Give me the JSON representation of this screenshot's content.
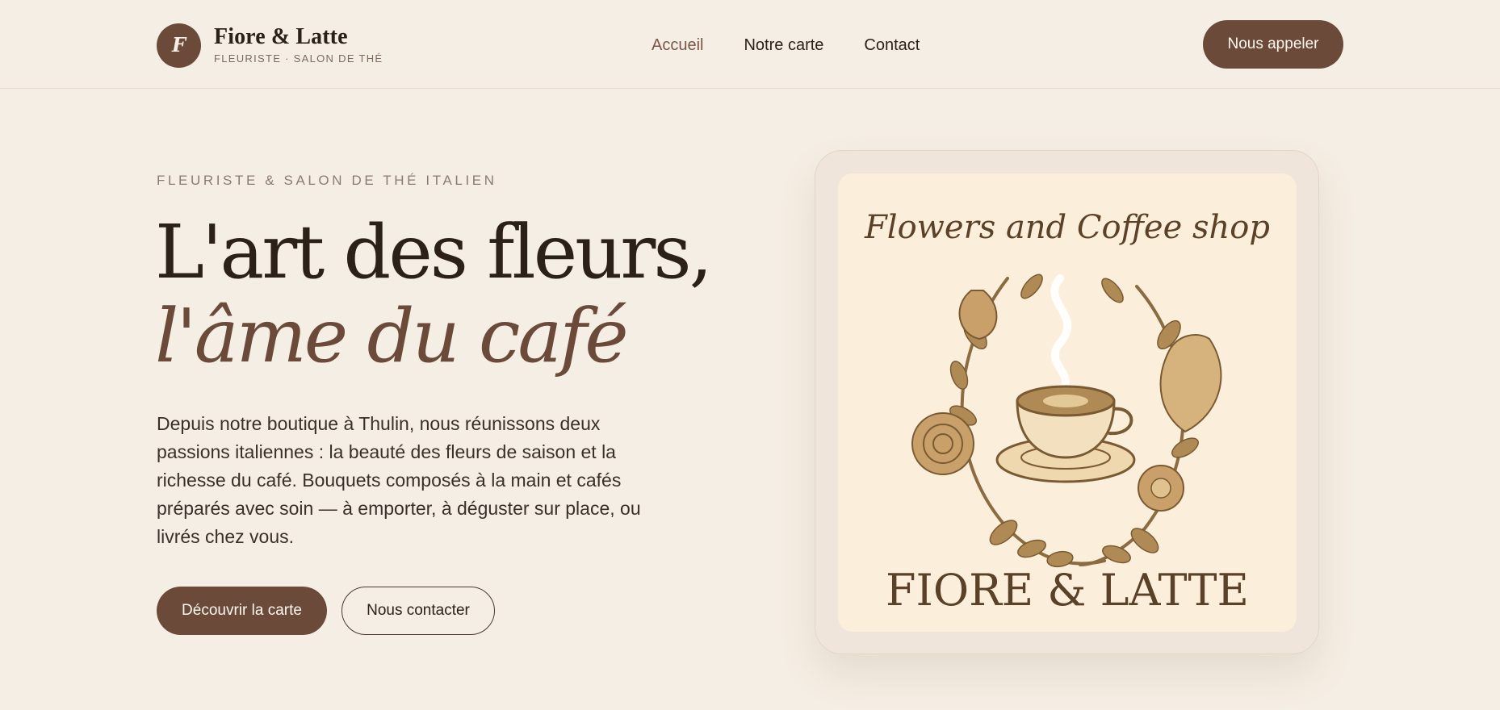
{
  "brand": {
    "monogram": "F",
    "name": "Fiore & Latte",
    "subtitle": "FLEURISTE · SALON DE THÉ"
  },
  "nav": {
    "items": [
      {
        "label": "Accueil",
        "active": true
      },
      {
        "label": "Notre carte",
        "active": false
      },
      {
        "label": "Contact",
        "active": false
      }
    ],
    "call_label": "Nous appeler"
  },
  "hero": {
    "eyebrow": "FLEURISTE & SALON DE THÉ ITALIEN",
    "title_line1": "L'art des fleurs,",
    "title_line2": "l'âme du café",
    "intro": "Depuis notre boutique à Thulin, nous réunissons deux passions italiennes : la beauté des fleurs de saison et la richesse du café. Bouquets composés à la main et cafés préparés avec soin — à emporter, à déguster sur place, ou livrés chez vous.",
    "primary_cta": "Découvrir la carte",
    "secondary_cta": "Nous contacter"
  },
  "logo": {
    "script_text": "Flowers and Coffee shop",
    "wordmark": "FIORE & LATTE"
  },
  "colors": {
    "background": "#f5eee4",
    "accent": "#6b4a3a",
    "text": "#2b211b",
    "logo_bg": "#fbeedb",
    "logo_gold": "#b08a55",
    "logo_text": "#5a4128"
  }
}
